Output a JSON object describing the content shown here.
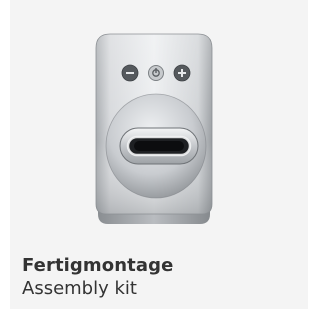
{
  "product": {
    "title": "Fertigmontage",
    "subtitle": "Assembly kit",
    "image": {
      "name": "handle-lock-escutcheon-image",
      "buttons": [
        "minus-icon",
        "power-icon",
        "plus-icon"
      ],
      "material": "brushed-stainless-steel"
    }
  },
  "colors": {
    "panel_background": "#f4f4f4",
    "text": "#333333",
    "metal_light": "#e2e4e6",
    "metal_dark": "#8e9296",
    "button": "#5a5e62"
  }
}
